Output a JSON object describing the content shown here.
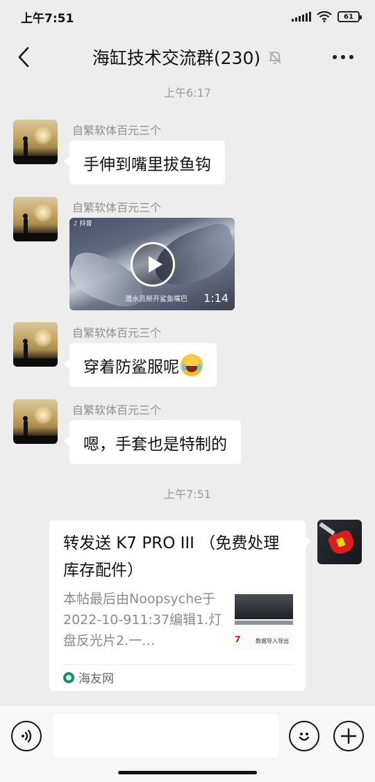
{
  "status_bar": {
    "time": "上午7:51",
    "battery": "61"
  },
  "header": {
    "title": "海缸技术交流群(230)",
    "back_icon": "back-arrow-icon",
    "mute_icon": "bell-muted-icon",
    "more_icon": "more-dots-icon"
  },
  "timestamps": [
    "上午6:17",
    "上午7:51"
  ],
  "messages": [
    {
      "sender": "自繁软体百元三个",
      "type": "text",
      "text": "手伸到嘴里拔鱼钩"
    },
    {
      "sender": "自繁软体百元三个",
      "type": "video",
      "app_tag": "抖音",
      "caption": "潜水员掰开鲨鱼嘴巴",
      "duration": "1:14"
    },
    {
      "sender": "自繁软体百元三个",
      "type": "text",
      "text": "穿着防鲨服呢",
      "emoji": "laughing-tears-emoji"
    },
    {
      "sender": "自繁软体百元三个",
      "type": "text",
      "text": "嗯，手套也是特制的"
    }
  ],
  "link_card": {
    "title": "转发送 K7 PRO III （免费处理库存配件）",
    "description": "本帖最后由Noopsyche于2022-10-911:37编辑1.灯盘反光片2.一…",
    "thumb_brand": "7",
    "thumb_text": "数据导入导出",
    "source": "海友网"
  },
  "input_bar": {
    "placeholder": ""
  },
  "colors": {
    "background": "#ededed",
    "bubble": "#ffffff",
    "meta_text": "#9a9a9a"
  }
}
